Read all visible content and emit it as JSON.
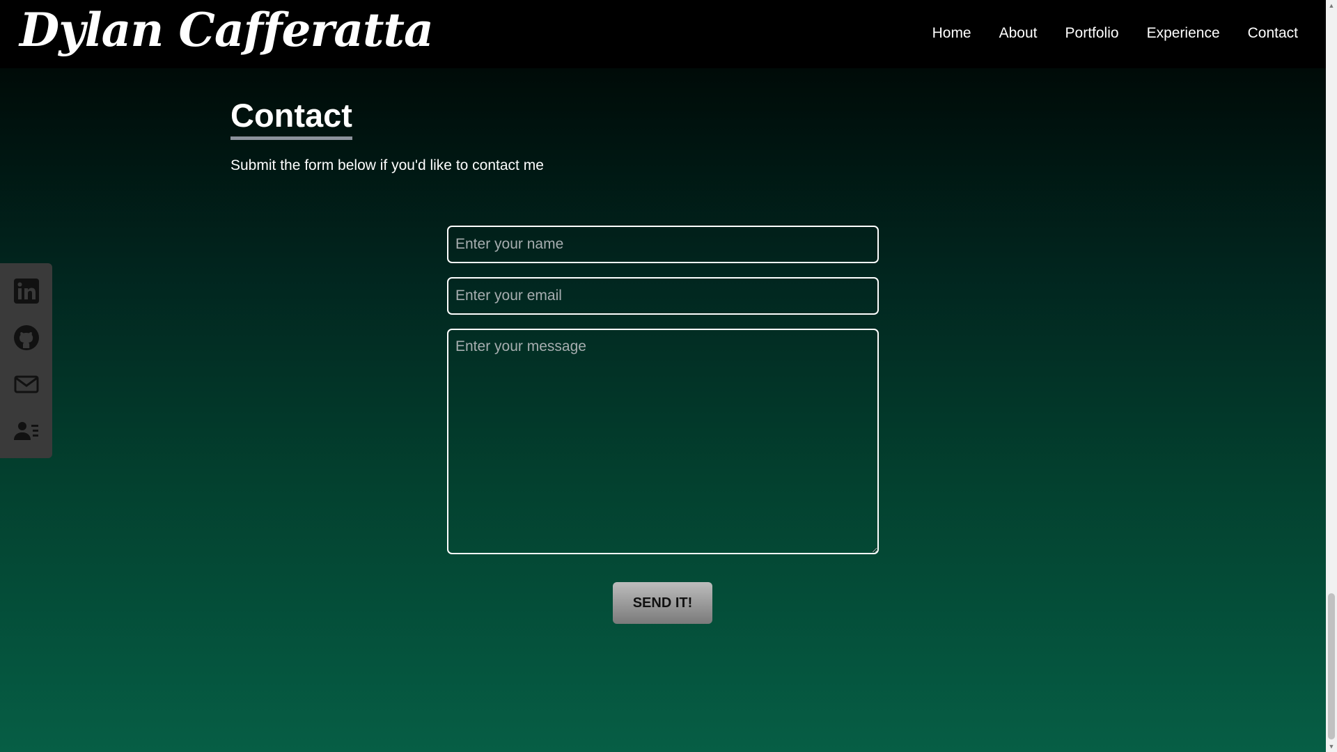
{
  "header": {
    "logo": "Dylan Cafferatta",
    "nav": [
      {
        "label": "Home"
      },
      {
        "label": "About"
      },
      {
        "label": "Portfolio"
      },
      {
        "label": "Experience"
      },
      {
        "label": "Contact"
      }
    ]
  },
  "social": [
    {
      "icon": "linkedin-icon"
    },
    {
      "icon": "github-icon"
    },
    {
      "icon": "mail-icon"
    },
    {
      "icon": "contact-card-icon"
    }
  ],
  "contact": {
    "title": "Contact",
    "intro": "Submit the form below if you'd like to contact me",
    "name_placeholder": "Enter your name",
    "email_placeholder": "Enter your email",
    "message_placeholder": "Enter your message",
    "submit_label": "SEND IT!"
  },
  "scrollbar": {
    "up_arrow": "▲",
    "down_arrow": "▼"
  }
}
